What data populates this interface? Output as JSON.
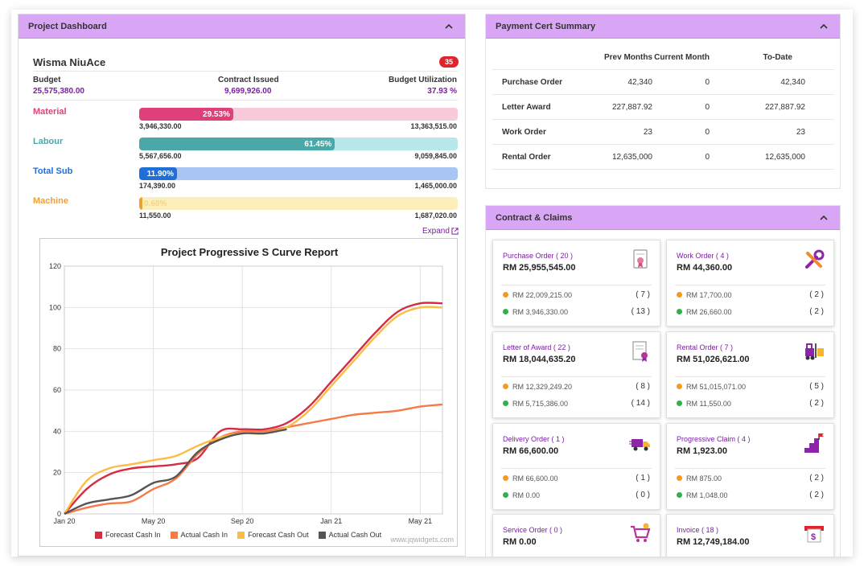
{
  "dashboard": {
    "header": "Project Dashboard",
    "project_name": "Wisma NiuAce",
    "badge": "35",
    "budget_label": "Budget",
    "budget_value": "25,575,380.00",
    "contract_label": "Contract Issued",
    "contract_value": "9,699,926.00",
    "util_label": "Budget Utilization",
    "util_value": "37.93 %",
    "expand_label": "Expand",
    "bars": [
      {
        "label": "Material",
        "percent_text": "29.53%",
        "fraction": 0.2953,
        "min": "3,946,330.00",
        "max": "13,363,515.00",
        "color": "#e0407a",
        "track": "#f8cbdc",
        "label_color": "#e0407a"
      },
      {
        "label": "Labour",
        "percent_text": "61.45%",
        "fraction": 0.6145,
        "min": "5,567,656.00",
        "max": "9,059,845.00",
        "color": "#4aa8a8",
        "track": "#b8e8ea",
        "label_color": "#4aa8a8"
      },
      {
        "label": "Total Sub",
        "percent_text": "11.90%",
        "fraction": 0.119,
        "min": "174,390.00",
        "max": "1,465,000.00",
        "color": "#1f6fd6",
        "track": "#a9c6f2",
        "label_color": "#1f6fd6"
      },
      {
        "label": "Machine",
        "percent_text": "0.68%",
        "fraction": 0.0068,
        "min": "11,550.00",
        "max": "1,687,020.00",
        "color": "#f0a030",
        "track": "#fdefbb",
        "label_color": "#f0a030"
      }
    ]
  },
  "chart_data": {
    "type": "line",
    "title": "Project Progressive S Curve Report",
    "xlabel": "",
    "ylabel": "",
    "x_ticks": [
      "Jan 20",
      "May 20",
      "Sep 20",
      "Jan 21",
      "May 21"
    ],
    "y_ticks": [
      0,
      20,
      40,
      60,
      80,
      100,
      120
    ],
    "ylim": [
      0,
      120
    ],
    "x_range_months": [
      0,
      17
    ],
    "grid": true,
    "legend_position": "bottom",
    "watermark": "www.jqwidgets.com",
    "series": [
      {
        "name": "Forecast Cash In",
        "color": "#d62b45",
        "x": [
          0,
          1,
          2,
          3,
          4,
          5,
          6,
          7,
          8,
          9,
          10,
          11,
          12,
          13,
          14,
          15,
          16,
          17
        ],
        "values": [
          0,
          12,
          19,
          22,
          23,
          24,
          27,
          40,
          41,
          41,
          44,
          52,
          64,
          76,
          88,
          98,
          102,
          102
        ]
      },
      {
        "name": "Actual Cash In",
        "color": "#f57a45",
        "x": [
          0,
          1,
          2,
          3,
          4,
          5,
          6,
          7,
          8,
          9,
          10,
          11,
          12,
          13,
          14,
          15,
          16,
          17
        ],
        "values": [
          0,
          3,
          5,
          6,
          12,
          17,
          29,
          37,
          40,
          40,
          42,
          44,
          46,
          48,
          49,
          50,
          52,
          53
        ]
      },
      {
        "name": "Forecast Cash Out",
        "color": "#fcbc45",
        "x": [
          0,
          1,
          2,
          3,
          4,
          5,
          6,
          7,
          8,
          9,
          10,
          11,
          12,
          13,
          14,
          15,
          16,
          17
        ],
        "values": [
          0,
          16,
          22,
          24,
          26,
          28,
          33,
          37,
          39,
          39,
          42,
          50,
          62,
          74,
          86,
          96,
          100,
          100
        ]
      },
      {
        "name": "Actual Cash Out",
        "color": "#555555",
        "x": [
          0,
          1,
          2,
          3,
          4,
          5,
          6,
          7,
          8,
          9,
          10
        ],
        "values": [
          0,
          5,
          7,
          9,
          15,
          18,
          30,
          36,
          39,
          39,
          41
        ]
      }
    ]
  },
  "payment": {
    "header": "Payment Cert Summary",
    "columns": [
      "Prev Months",
      "Current Month",
      "To-Date"
    ],
    "rows": [
      {
        "name": "Purchase Order",
        "prev": "42,340",
        "current": "0",
        "todate": "42,340"
      },
      {
        "name": "Letter Award",
        "prev": "227,887.92",
        "current": "0",
        "todate": "227,887.92"
      },
      {
        "name": "Work Order",
        "prev": "23",
        "current": "0",
        "todate": "23"
      },
      {
        "name": "Rental Order",
        "prev": "12,635,000",
        "current": "0",
        "todate": "12,635,000"
      }
    ]
  },
  "contract": {
    "header": "Contract & Claims",
    "cards": [
      {
        "title": "Purchase Order ( 20 )",
        "amount": "RM 25,955,545.00",
        "icon": "document-seal-icon",
        "r1": "RM 22,009,215.00",
        "c1": "( 7 )",
        "r2": "RM 3,946,330.00",
        "c2": "( 13 )"
      },
      {
        "title": "Work Order ( 4 )",
        "amount": "RM 44,360.00",
        "icon": "tools-icon",
        "r1": "RM 17,700.00",
        "c1": "( 2 )",
        "r2": "RM 26,660.00",
        "c2": "( 2 )"
      },
      {
        "title": "Letter of Award ( 22 )",
        "amount": "RM 18,044,635.20",
        "icon": "certificate-icon",
        "r1": "RM 12,329,249.20",
        "c1": "( 8 )",
        "r2": "RM 5,715,386.00",
        "c2": "( 14 )"
      },
      {
        "title": "Rental Order ( 7 )",
        "amount": "RM 51,026,621.00",
        "icon": "forklift-icon",
        "r1": "RM 51,015,071.00",
        "c1": "( 5 )",
        "r2": "RM 11,550.00",
        "c2": "( 2 )"
      },
      {
        "title": "Delivery Order ( 1 )",
        "amount": "RM 66,600.00",
        "icon": "truck-icon",
        "r1": "RM 66,600.00",
        "c1": "( 1 )",
        "r2": "RM 0.00",
        "c2": "( 0 )"
      },
      {
        "title": "Progressive Claim ( 4 )",
        "amount": "RM 1,923.00",
        "icon": "stairs-flag-icon",
        "r1": "RM 875.00",
        "c1": "( 2 )",
        "r2": "RM 1,048.00",
        "c2": "( 2 )"
      },
      {
        "title": "Service Order ( 0 )",
        "amount": "RM 0.00",
        "icon": "cart-icon"
      },
      {
        "title": "Invoice ( 18 )",
        "amount": "RM 12,749,184.00",
        "icon": "invoice-icon"
      }
    ],
    "dot_colors": {
      "pending": "#f59b1c",
      "done": "#2fb14a"
    }
  }
}
